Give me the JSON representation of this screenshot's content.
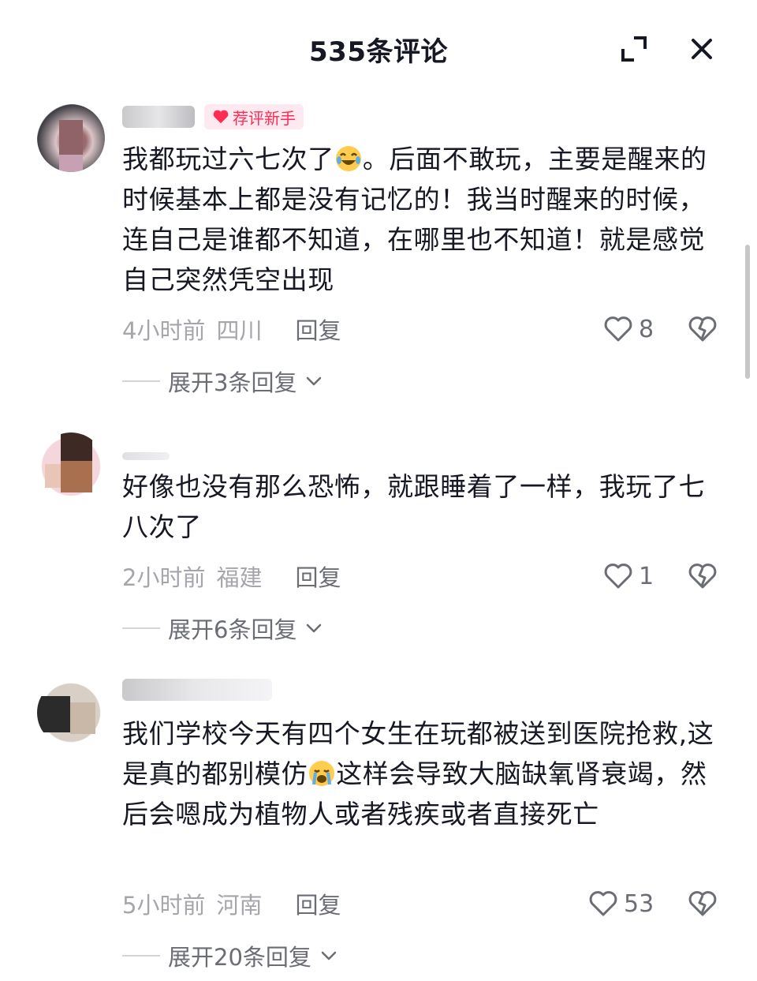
{
  "header": {
    "title": "535条评论"
  },
  "comments": [
    {
      "badge": "荐评新手",
      "text_before": "我都玩过六七次了",
      "text_after": "。后面不敢玩，主要是醒来的时候基本上都是没有记忆的！我当时醒来的时候，连自己是谁都不知道，在哪里也不知道！就是感觉自己突然凭空出现",
      "emoji": "laugh-cry-emoji",
      "time": "4小时前",
      "location": "四川",
      "reply_label": "回复",
      "likes": "8",
      "expand_label": "展开3条回复"
    },
    {
      "text": "好像也没有那么恐怖，就跟睡着了一样，我玩了七八次了",
      "time": "2小时前",
      "location": "福建",
      "reply_label": "回复",
      "likes": "1",
      "expand_label": "展开6条回复"
    },
    {
      "text_before": "我们学校今天有四个女生在玩都被送到医院抢救,这是真的都别模仿",
      "text_after": "这样会导致大脑缺氧肾衰竭，然后会嗯成为植物人或者残疾或者直接死亡",
      "emoji": "crying-emoji",
      "time": "5小时前",
      "location": "河南",
      "reply_label": "回复",
      "likes": "53",
      "expand_label": "展开20条回复"
    }
  ],
  "colors": {
    "accent": "#fe2c55",
    "muted": "#a5a6ab",
    "text": "#161823"
  }
}
